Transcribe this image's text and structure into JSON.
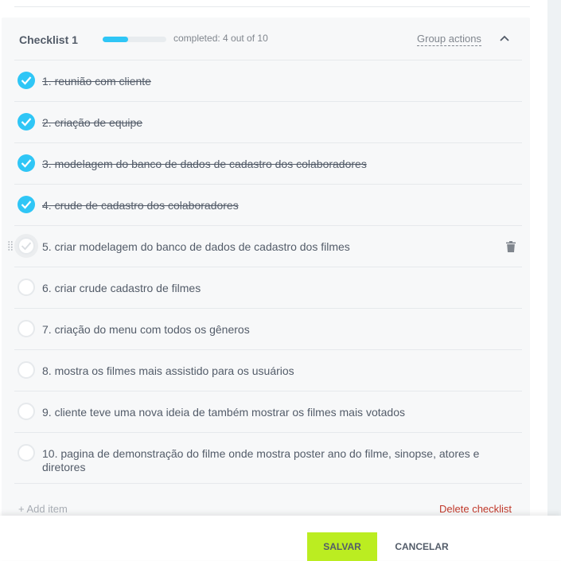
{
  "checklist": {
    "title": "Checklist 1",
    "progress_fraction": 0.4,
    "progress_text": "completed: 4 out of 10",
    "group_actions": "Group actions",
    "items": [
      {
        "text": "1. reunião com cliente",
        "done": true
      },
      {
        "text": "2. criação de equipe",
        "done": true
      },
      {
        "text": "3. modelagem do banco de dados de cadastro dos colaboradores",
        "done": true
      },
      {
        "text": "4. crude de cadastro dos colaboradores",
        "done": true
      },
      {
        "text": "5. criar modelagem do banco de dados de cadastro dos filmes",
        "done": false
      },
      {
        "text": "6. criar crude cadastro de filmes",
        "done": false
      },
      {
        "text": "7. criação do menu com todos os gêneros",
        "done": false
      },
      {
        "text": "8. mostra os filmes mais assistido para os usuários",
        "done": false
      },
      {
        "text": "9. cliente teve uma nova ideia de também mostrar os filmes mais votados",
        "done": false
      },
      {
        "text": "10. pagina de demonstração do filme onde mostra poster ano do filme, sinopse, atores e diretores",
        "done": false
      }
    ],
    "add_item": "+ Add item",
    "delete_checklist": "Delete checklist"
  },
  "footer": {
    "save_label": "SALVAR",
    "cancel_label": "CANCELAR"
  },
  "colors": {
    "accent": "#2fc6f6",
    "save": "#bbed21",
    "delete": "#c0392b"
  },
  "icons": [
    "checkmark-icon",
    "chevron-up-icon",
    "drag-handle-icon",
    "trash-icon"
  ]
}
